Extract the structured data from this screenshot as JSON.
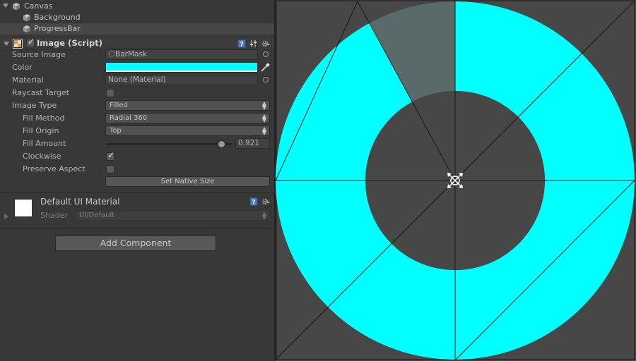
{
  "hierarchy": {
    "items": [
      {
        "label": "Canvas",
        "selected": false
      },
      {
        "label": "Background",
        "selected": false
      },
      {
        "label": "ProgressBar",
        "selected": true
      }
    ]
  },
  "component": {
    "title": "Image (Script)",
    "enabled": true,
    "properties": {
      "source_image": {
        "label": "Source Image",
        "value": "BarMask"
      },
      "color": {
        "label": "Color",
        "value": "#00ffff"
      },
      "material": {
        "label": "Material",
        "value": "None (Material)"
      },
      "raycast_target": {
        "label": "Raycast Target",
        "checked": false
      },
      "image_type": {
        "label": "Image Type",
        "value": "Filled"
      },
      "fill_method": {
        "label": "Fill Method",
        "value": "Radial 360"
      },
      "fill_origin": {
        "label": "Fill Origin",
        "value": "Top"
      },
      "fill_amount": {
        "label": "Fill Amount",
        "value": "0.921",
        "fraction": 0.921
      },
      "clockwise": {
        "label": "Clockwise",
        "checked": true
      },
      "preserve_aspect": {
        "label": "Preserve Aspect",
        "checked": false
      }
    },
    "set_native_size_label": "Set Native Size"
  },
  "material_section": {
    "name": "Default UI Material",
    "shader_label": "Shader",
    "shader_value": "UI/Default"
  },
  "add_component_label": "Add Component",
  "scene": {
    "fill_color": "#00ffff",
    "background_color": "#474747",
    "fill_amount": 0.921,
    "fill_origin": "Top",
    "clockwise": true
  }
}
